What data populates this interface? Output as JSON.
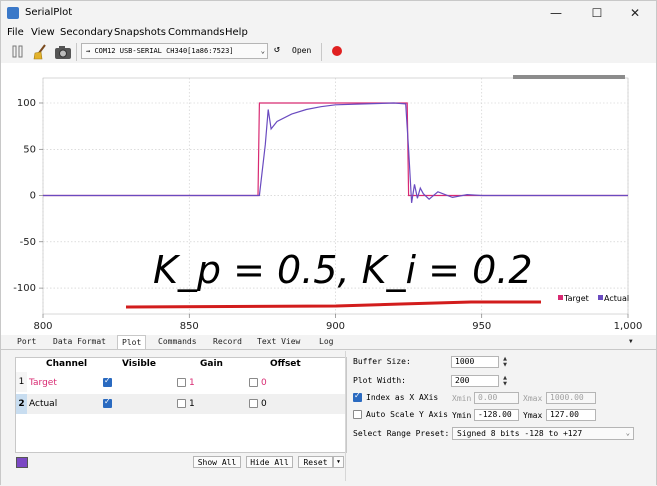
{
  "window": {
    "title": "SerialPlot",
    "minimize": "—",
    "maximize": "☐",
    "close": "✕"
  },
  "menu": [
    "File",
    "View",
    "Secondary",
    "Snapshots",
    "Commands",
    "Help"
  ],
  "toolbar": {
    "port": "COM12 USB-SERIAL CH340[1a86:7523]",
    "port_arrow": "⌄",
    "refresh": "↺",
    "open_label": "Open"
  },
  "plot": {
    "annotation": "K_p = 0.5, K_i = 0.2",
    "legend": {
      "target": "Target",
      "actual": "Actual"
    }
  },
  "chart_data": {
    "type": "line",
    "xlim": [
      800,
      1000
    ],
    "ylim": [
      -128,
      127
    ],
    "x_ticks": [
      "800",
      "850",
      "900",
      "950",
      "1,000"
    ],
    "y_ticks": [
      "100",
      "50",
      "0",
      "-50",
      "-100"
    ],
    "grid": true,
    "legend_position": "bottom-right",
    "colors": {
      "target": "#d82a72",
      "actual": "#6a4bc0"
    },
    "series": [
      {
        "name": "Target",
        "x": [
          800,
          873.5,
          874,
          924.5,
          925,
          1000
        ],
        "y": [
          0,
          0,
          100,
          100,
          0,
          0
        ]
      },
      {
        "name": "Actual",
        "x": [
          800,
          874,
          876,
          877,
          878,
          880,
          885,
          890,
          895,
          900,
          910,
          920,
          924,
          925,
          926,
          927,
          928,
          929,
          930,
          932,
          935,
          940,
          945,
          950,
          960,
          1000
        ],
        "y": [
          0,
          0,
          55,
          93,
          72,
          80,
          88,
          93,
          96,
          98,
          99,
          100,
          99,
          50,
          -8,
          12,
          -3,
          8,
          2,
          -4,
          4,
          -2,
          1,
          0,
          0,
          0
        ]
      }
    ]
  },
  "tabs": [
    "Port",
    "Data Format",
    "Plot",
    "Commands",
    "Record",
    "Text View",
    "Log"
  ],
  "tabs_more_arrow": "▼",
  "channels": {
    "headers": {
      "channel": "Channel",
      "visible": "Visible",
      "gain": "Gain",
      "offset": "Offset"
    },
    "rows": [
      {
        "num": "1",
        "name": "Target",
        "color": "#d82a72",
        "visible": true,
        "gain": "1",
        "offset": "0"
      },
      {
        "num": "2",
        "name": "Actual",
        "color": "#000000",
        "visible": true,
        "gain": "1",
        "offset": "0"
      }
    ],
    "show_all": "Show All",
    "hide_all": "Hide All",
    "reset": "Reset",
    "reset_arrow": "▼"
  },
  "settings": {
    "buffer_size_label": "Buffer Size:",
    "buffer_size": "1000",
    "plot_width_label": "Plot Width:",
    "plot_width": "200",
    "index_as_x_label": "Index as X AXis",
    "xmin_label": "Xmin",
    "xmin": "0.00",
    "xmax_label": "Xmax",
    "xmax": "1000.00",
    "auto_scale_label": "Auto Scale Y Axis",
    "ymin_label": "Ymin",
    "ymin": "-128.00",
    "ymax_label": "Ymax",
    "ymax": "127.00",
    "range_preset_label": "Select Range Preset:",
    "range_preset": "Signed 8 bits -128 to +127",
    "range_arrow": "⌄"
  }
}
